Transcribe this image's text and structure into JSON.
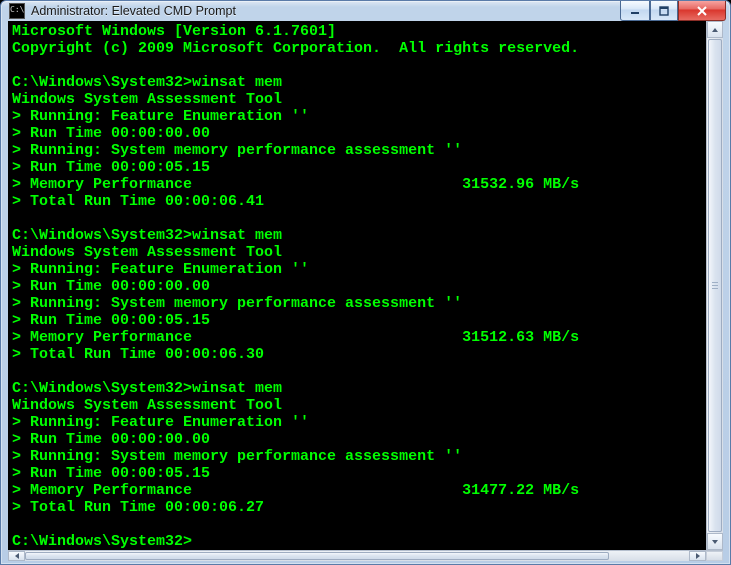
{
  "window": {
    "title": "Administrator: Elevated CMD Prompt",
    "icon_glyph": "C:\\"
  },
  "controls": {
    "minimize_tip": "Minimize",
    "maximize_tip": "Maximize",
    "close_tip": "Close"
  },
  "terminal": {
    "header_line1": "Microsoft Windows [Version 6.1.7601]",
    "header_line2": "Copyright (c) 2009 Microsoft Corporation.  All rights reserved.",
    "prompt_path": "C:\\Windows\\System32>",
    "command": "winsat mem",
    "tool_name": "Windows System Assessment Tool",
    "line_feat_enum": "> Running: Feature Enumeration ''",
    "line_runtime_zero": "> Run Time 00:00:00.00",
    "line_mem_assess": "> Running: System memory performance assessment ''",
    "runs": [
      {
        "run_time_assess": "> Run Time 00:00:05.15",
        "mem_perf_label": "> Memory Performance",
        "mem_perf_value": "31532.96 MB/s",
        "total_run_time": "> Total Run Time 00:00:06.41"
      },
      {
        "run_time_assess": "> Run Time 00:00:05.15",
        "mem_perf_label": "> Memory Performance",
        "mem_perf_value": "31512.63 MB/s",
        "total_run_time": "> Total Run Time 00:00:06.30"
      },
      {
        "run_time_assess": "> Run Time 00:00:05.15",
        "mem_perf_label": "> Memory Performance",
        "mem_perf_value": "31477.22 MB/s",
        "total_run_time": "> Total Run Time 00:00:06.27"
      }
    ]
  }
}
